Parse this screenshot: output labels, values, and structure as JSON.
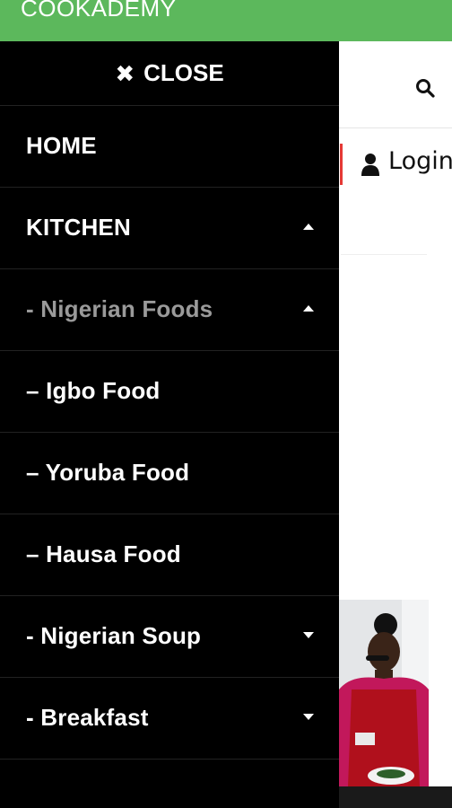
{
  "app": {
    "brand": "COOKADEMY"
  },
  "drawer": {
    "close_label": "CLOSE",
    "items": [
      {
        "label": "HOME",
        "caret": ""
      },
      {
        "label": "KITCHEN",
        "caret": "up"
      },
      {
        "label": "- Nigerian Foods",
        "caret": "up"
      },
      {
        "label": "– Igbo Food",
        "caret": ""
      },
      {
        "label": "– Yoruba Food",
        "caret": ""
      },
      {
        "label": "– Hausa Food",
        "caret": ""
      },
      {
        "label": "- Nigerian Soup",
        "caret": "down"
      },
      {
        "label": "- Breakfast",
        "caret": "down"
      }
    ]
  },
  "page": {
    "login_label": "Login"
  },
  "colors": {
    "topbar": "#5cb85c",
    "drawer_bg": "#000000",
    "active_item": "#9a9a9a",
    "divider_accent": "#e53935"
  },
  "icons": {
    "search": "search-icon",
    "user": "user-icon",
    "close": "close-icon"
  }
}
